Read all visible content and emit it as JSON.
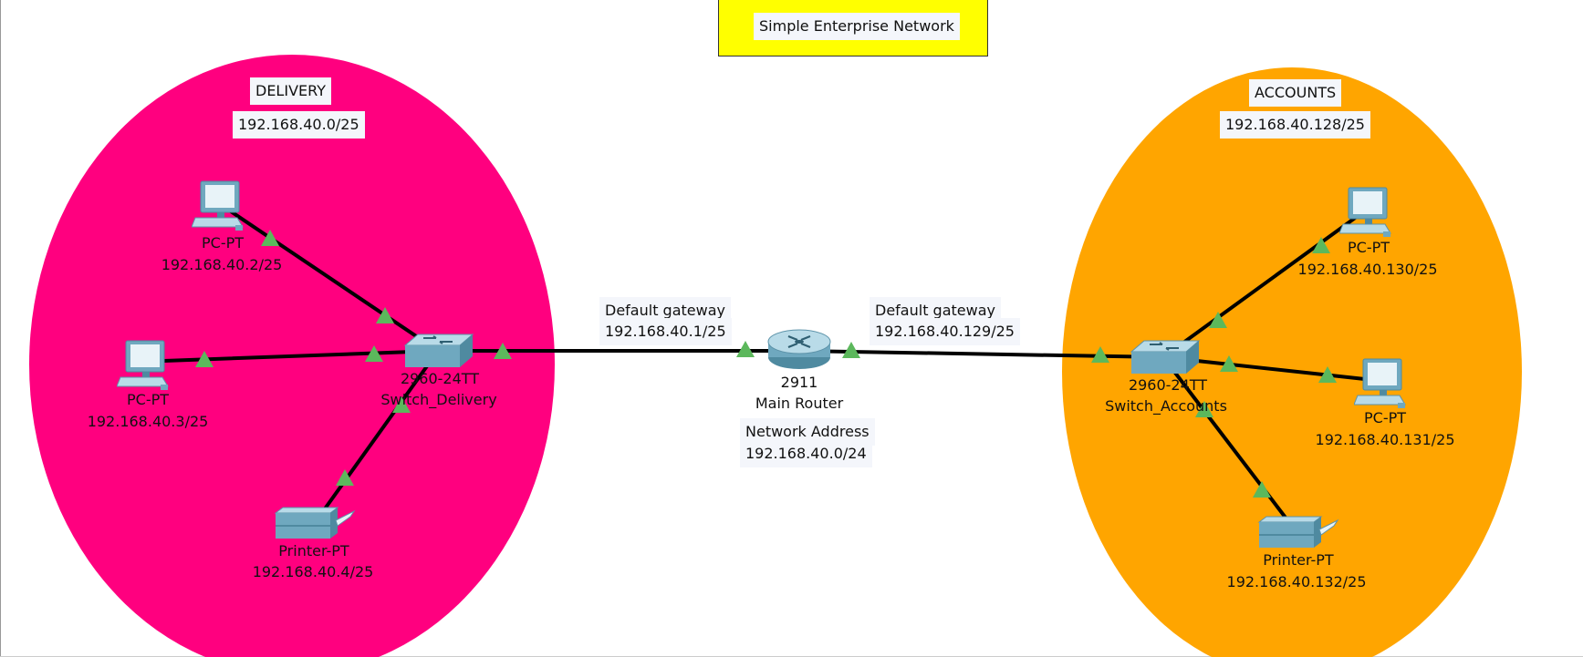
{
  "title": {
    "text": "Simple Enterprise Network",
    "color": "#ffff00"
  },
  "zones": {
    "delivery": {
      "name": "DELIVERY",
      "subnet": "192.168.40.0/25",
      "color": "#ff007f"
    },
    "accounts": {
      "name": "ACCOUNTS",
      "subnet": "192.168.40.128/25",
      "color": "#ffa500"
    }
  },
  "router": {
    "model": "2911",
    "name": "Main Router",
    "gateway_left": {
      "label": "Default gateway",
      "ip": "192.168.40.1/25"
    },
    "gateway_right": {
      "label": "Default gateway",
      "ip": "192.168.40.129/25"
    },
    "network": {
      "label": "Network Address",
      "ip": "192.168.40.0/24"
    }
  },
  "switches": {
    "delivery": {
      "model": "2960-24TT",
      "name": "Switch_Delivery"
    },
    "accounts": {
      "model": "2960-24TT",
      "name": "Switch_Accounts"
    }
  },
  "devices": {
    "delivery_pc1": {
      "type": "PC-PT",
      "ip": "192.168.40.2/25"
    },
    "delivery_pc2": {
      "type": "PC-PT",
      "ip": "192.168.40.3/25"
    },
    "delivery_printer": {
      "type": "Printer-PT",
      "ip": "192.168.40.4/25"
    },
    "accounts_pc1": {
      "type": "PC-PT",
      "ip": "192.168.40.130/25"
    },
    "accounts_pc2": {
      "type": "PC-PT",
      "ip": "192.168.40.131/25"
    },
    "accounts_printer": {
      "type": "Printer-PT",
      "ip": "192.168.40.132/25"
    }
  },
  "link_status_color": "#5cb85c",
  "icons": {
    "pc": "pc-icon",
    "printer": "printer-icon",
    "switch": "switch-icon",
    "router": "router-icon"
  }
}
